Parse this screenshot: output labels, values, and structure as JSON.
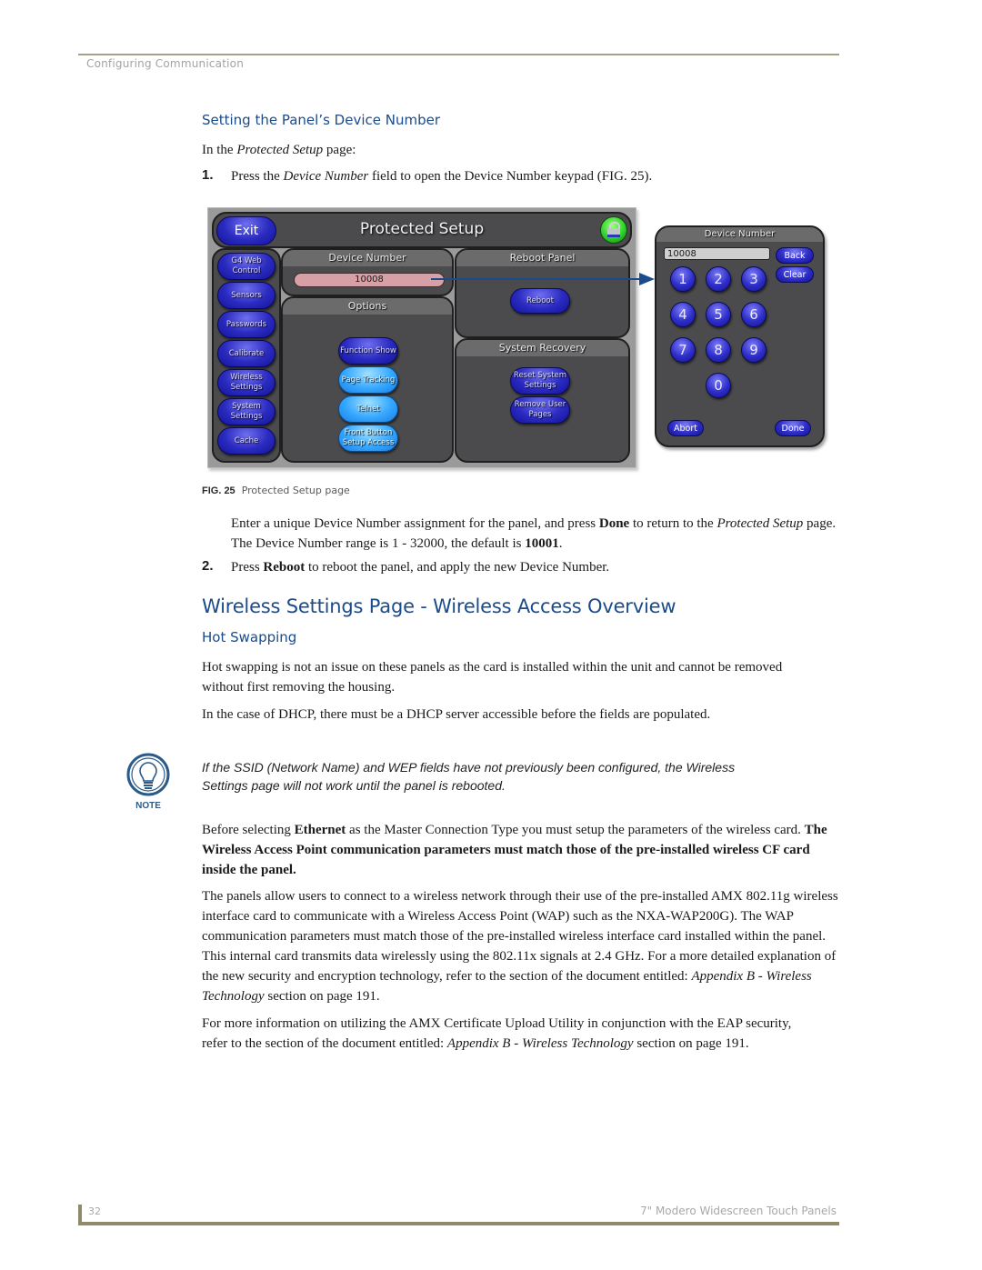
{
  "header": {
    "running_head": "Configuring Communication"
  },
  "section1": {
    "heading": "Setting the Panel’s Device Number",
    "intro_pre": "In the ",
    "intro_em": "Protected Setup",
    "intro_post": " page:",
    "step1_num": "1.",
    "step1_pre": "Press the ",
    "step1_em": "Device Number",
    "step1_post": " field to open the Device Number keypad (FIG. 25)."
  },
  "figure": {
    "protected_setup": {
      "exit_label": "Exit",
      "title": "Protected Setup",
      "lock_icon": "lock-icon",
      "sidebar_buttons": [
        "G4 Web Control",
        "Sensors",
        "Passwords",
        "Calibrate",
        "Wireless Settings",
        "System Settings",
        "Cache"
      ],
      "device_number_header": "Device Number",
      "device_number_value": "10008",
      "options_header": "Options",
      "options_buttons": [
        "Function Show",
        "Page Tracking",
        "Telnet",
        "Front Button Setup Access"
      ],
      "reboot_header": "Reboot Panel",
      "reboot_button": "Reboot",
      "recovery_header": "System Recovery",
      "recovery_buttons": [
        "Reset System Settings",
        "Remove User Pages"
      ]
    },
    "keypad": {
      "title": "Device Number",
      "value": "10008",
      "back": "Back",
      "clear": "Clear",
      "digits": [
        "1",
        "2",
        "3",
        "4",
        "5",
        "6",
        "7",
        "8",
        "9",
        "0"
      ],
      "abort": "Abort",
      "done": "Done"
    },
    "caption_label": "FIG. 25",
    "caption_text": "Protected Setup page"
  },
  "section1_after": {
    "p1_a": "Enter a unique Device Number assignment for the panel, and press ",
    "p1_b_bold": "Done",
    "p1_c": " to return to the ",
    "p1_d_em": "Protected",
    "p1_e_em": "Setup",
    "p1_f": " page. The Device Number range is 1 - 32000, the default is ",
    "p1_g_bold": "10001",
    "p1_h": ".",
    "step2_num": "2.",
    "step2_pre": "Press ",
    "step2_bold": "Reboot",
    "step2_post": " to reboot the panel, and apply the new Device Number."
  },
  "section2": {
    "heading": "Wireless Settings Page - Wireless Access Overview",
    "subheading": "Hot Swapping",
    "p1": "Hot swapping is not an issue on these panels as the card is installed within the unit and cannot be removed without first removing the housing.",
    "p2": "In the case of DHCP, there must be a DHCP server accessible before the fields are populated.",
    "note_label": "NOTE",
    "note_text": "If the SSID (Network Name) and WEP fields have not previously been configured, the Wireless Settings page will not work until the panel is rebooted.",
    "p3_a": "Before selecting ",
    "p3_b_bold": "Ethernet",
    "p3_c": " as the Master Connection Type you must setup the parameters of the wireless card. ",
    "p3_d_bold": "The Wireless Access Point communication parameters must match those of the pre-installed wireless CF card inside the panel.",
    "p4_a": "The panels allow users to connect to a wireless network through their use of the pre-installed AMX 802.11g wireless interface card to communicate with a Wireless Access Point (WAP) such as the NXA-WAP200G). The WAP communication parameters must match those of the pre-installed wireless interface card installed within the panel. This internal card transmits data wirelessly using the 802.11x signals at 2.4 GHz. For a more detailed explanation of the new security and encryption technology, refer to the section of the document entitled: ",
    "p4_b_em": "Appendix B - Wireless Technology",
    "p4_c": " section on page 191.",
    "p5_a": "For more information on utilizing the AMX Certificate Upload Utility in conjunction with the EAP security, refer to the section of the document entitled: ",
    "p5_b_em": "Appendix B - Wireless Technology",
    "p5_c": " section on page 191."
  },
  "footer": {
    "page_number": "32",
    "title": "7\" Modero Widescreen Touch Panels"
  },
  "colors": {
    "heading_blue": "#1a4b8a",
    "rule_olive": "#a4a184",
    "panel_dark": "#4b4a4c",
    "button_blue": "#2a2ac0",
    "button_light_blue": "#36a8ff",
    "field_pink": "#d7a0a6",
    "lock_green": "#2ed12b"
  }
}
